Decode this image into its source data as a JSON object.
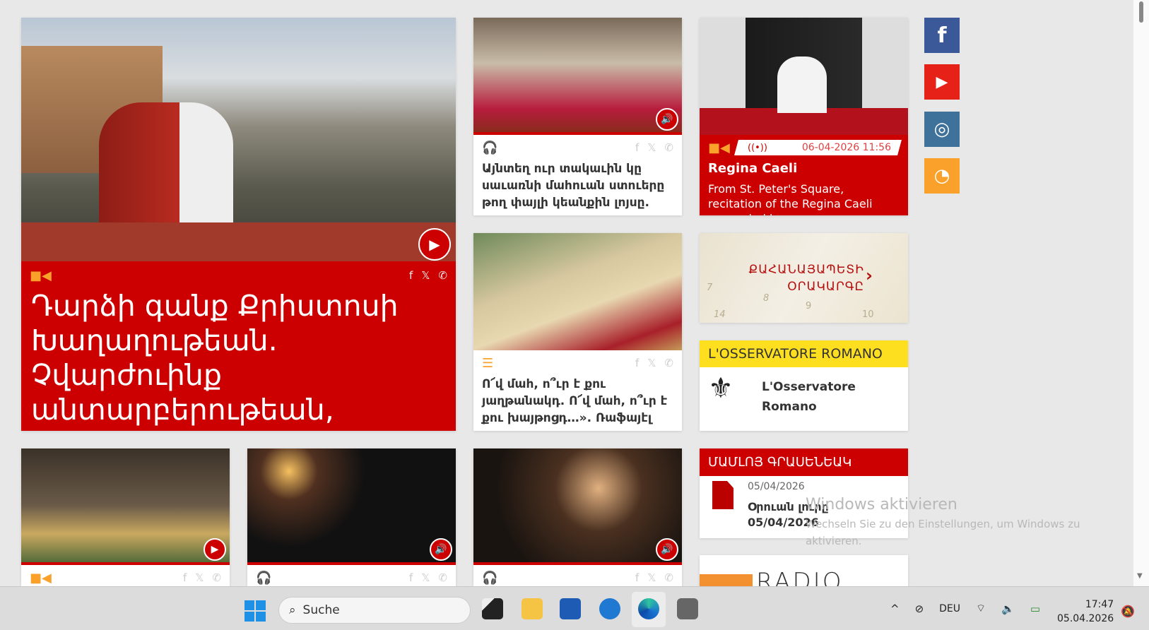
{
  "main_story": {
    "title": "Դարձի գանք Քրիստոսի Խաղաղութեան. Չվարժուինք անտարբերութեան,",
    "type": "video"
  },
  "story2": {
    "title": "Այնտեղ ուր տակաւին կը սաւառնի մահուան ստուերը թող փայլի կեանքին լոյսը.",
    "type": "audio"
  },
  "story3": {
    "title": "Ո՜վ մահ, ո՞ւր է քու յաղթանակդ. Ո՜վ մահ, ո՞ւր է քու խայթոցդ…». Ռաֆայէլ",
    "type": "article"
  },
  "live": {
    "datetime": "06-04-2026 11:56",
    "title": "Regina Caeli",
    "description": "From St. Peter's Square, recitation of the Regina Caeli prayer led by..."
  },
  "calendar": {
    "label_line1": "ՔԱՀԱՆԱՅԱՊԵՏԻ",
    "label_line2": "ՕՐԱԿԱՐԳԸ",
    "numbers": [
      "7",
      "8",
      "9",
      "10",
      "14"
    ]
  },
  "osservatore": {
    "header": "L'OSSERVATORE ROMANO",
    "name_line1": "L'Osservatore",
    "name_line2": "Romano"
  },
  "press": {
    "header": "ՄԱՄԼՈՅ ԳՐԱՍԵՆԵԱԿ",
    "date": "05/04/2026",
    "title_line1": "Օրուան լուրը",
    "title_line2": "05/04/2026"
  },
  "radio": {
    "label": "RADIO"
  },
  "social": [
    "facebook",
    "youtube",
    "instagram",
    "rss"
  ],
  "watermark": {
    "title": "Windows aktivieren",
    "line1": "Wechseln Sie zu den Einstellungen, um Windows zu",
    "line2": "aktivieren."
  },
  "taskbar": {
    "search_placeholder": "Suche",
    "language": "DEU",
    "time": "17:47",
    "date": "05.04.2026"
  },
  "colors": {
    "brand_red": "#cc0000",
    "accent_orange": "#f9a12a",
    "yellow": "#fddf20"
  }
}
